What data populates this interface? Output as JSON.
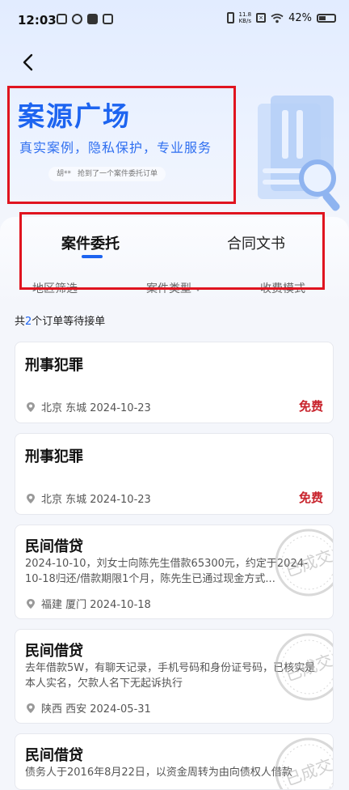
{
  "status_bar": {
    "time": "12:03",
    "network_speed": "11.8",
    "network_unit": "KB/s",
    "battery": "42%"
  },
  "header": {
    "title": "案源广场",
    "subtitle": "真实案例，隐私保护，专业服务",
    "ticker_user": "胡**",
    "ticker_text": "抢到了一个案件委托订单"
  },
  "tabs": [
    {
      "label": "案件委托",
      "active": true
    },
    {
      "label": "合同文书",
      "active": false
    }
  ],
  "filters": [
    "地区筛选",
    "案件类型",
    "收费模式"
  ],
  "summary": {
    "prefix": "共",
    "count": "2",
    "suffix": "个订单等待接单"
  },
  "cards": [
    {
      "title": "刑事犯罪",
      "desc": "",
      "location": "北京 东城 2024-10-23",
      "price": "免费",
      "stamp": ""
    },
    {
      "title": "刑事犯罪",
      "desc": "",
      "location": "北京 东城 2024-10-23",
      "price": "免费",
      "stamp": ""
    },
    {
      "title": "民间借贷",
      "desc": "2024-10-10，刘女士向陈先生借款65300元，约定于2024-10-18归还/借款期限1个月，陈先生已通过现金方式...",
      "location": "福建 厦门 2024-10-18",
      "price": "",
      "stamp": "已成交"
    },
    {
      "title": "民间借贷",
      "desc": "去年借款5W，有聊天记录，手机号码和身份证号码，已核实是本人实名，欠款人名下无起诉执行",
      "location": "陕西 西安 2024-05-31",
      "price": "",
      "stamp": "已成交"
    },
    {
      "title": "民间借贷",
      "desc": "债务人于2016年8月22日，以资金周转为由向债权人借款",
      "location": "",
      "price": "",
      "stamp": "已成交"
    }
  ],
  "colors": {
    "primary": "#1d64f0",
    "price": "#c8232c",
    "annotation_box": "#e0141f"
  }
}
